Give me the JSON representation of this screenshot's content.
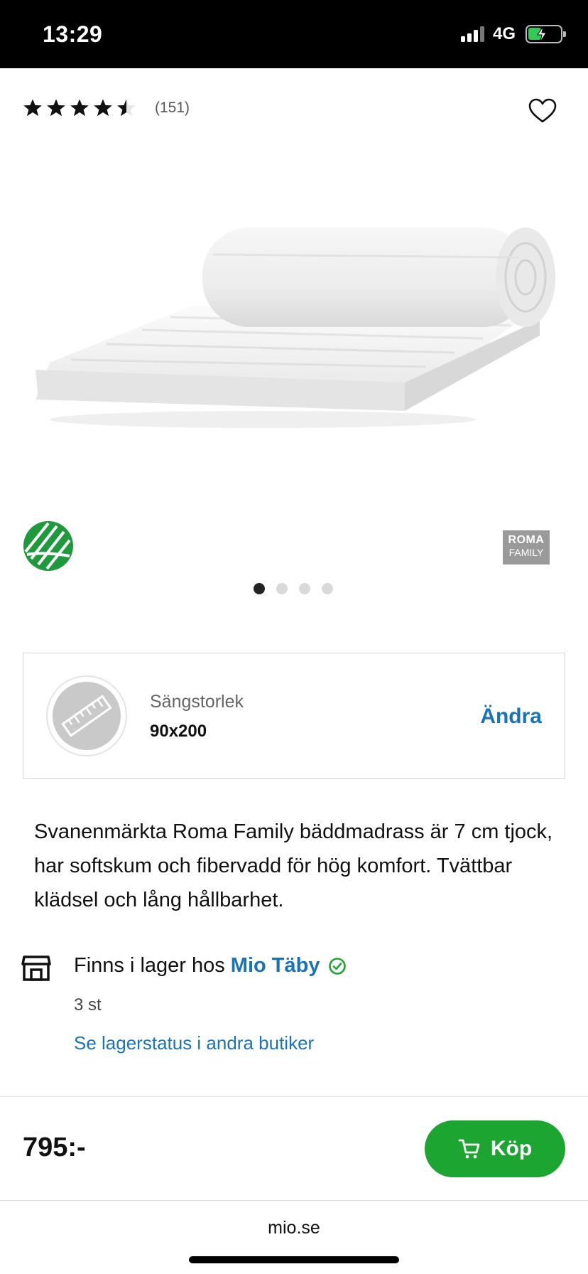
{
  "status_bar": {
    "time": "13:29",
    "network": "4G",
    "battery_charging": true
  },
  "product": {
    "rating": 4.5,
    "rating_max": 5,
    "review_count": "(151)",
    "image_alt": "Roma Family bäddmadrass",
    "brand_logo_line1": "ROMA",
    "brand_logo_line2": "FAMILY",
    "carousel": {
      "total": 4,
      "active": 1
    },
    "icons": {
      "eco": "swan-ecolabel-icon",
      "wishlist": "heart-icon"
    }
  },
  "size_selector": {
    "label": "Sängstorlek",
    "value": "90x200",
    "change_label": "Ändra",
    "icon": "ruler-icon"
  },
  "description": "Svanenmärkta Roma Family bäddmadrass är 7 cm tjock, har softskum och fibervadd för hög komfort. Tvättbar klädsel och lång hållbarhet.",
  "stock": {
    "prefix": "Finns i lager hos",
    "store": "Mio Täby",
    "quantity": "3 st",
    "link": "Se lagerstatus i andra butiker",
    "icon": "store-icon",
    "status_icon": "check-circle-icon",
    "status_color": "#1da531"
  },
  "purchase": {
    "price": "795:-",
    "buy_label": "Köp",
    "icon": "cart-icon",
    "button_color": "#1da531"
  },
  "browser": {
    "url": "mio.se"
  },
  "colors": {
    "accent": "#1a73b8",
    "buy": "#1da531"
  }
}
